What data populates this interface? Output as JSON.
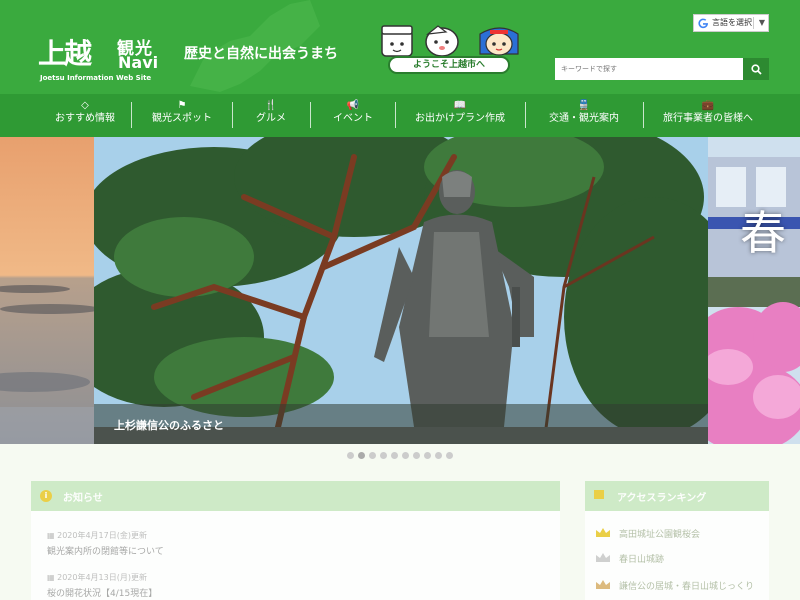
{
  "header": {
    "logo_mark": "上越",
    "logo_kanko": "観光",
    "logo_navi": "Navi",
    "logo_sub": "Joetsu Information Web Site",
    "tagline": "歴史と自然に出会うまち",
    "welcome": "ようこそ上越市へ",
    "language_button": "言語を選択",
    "search_placeholder": "キーワードで探す"
  },
  "nav": {
    "items": [
      {
        "label": "おすすめ情報",
        "icon": "diamond-icon"
      },
      {
        "label": "観光スポット",
        "icon": "flag-icon"
      },
      {
        "label": "グルメ",
        "icon": "cutlery-icon"
      },
      {
        "label": "イベント",
        "icon": "megaphone-icon"
      },
      {
        "label": "お出かけプラン作成",
        "icon": "book-icon"
      },
      {
        "label": "交通・観光案内",
        "icon": "train-icon"
      },
      {
        "label": "旅行事業者の皆様へ",
        "icon": "briefcase-icon"
      }
    ]
  },
  "hero": {
    "caption": "上杉謙信公のふるさと",
    "right_text": "春",
    "slide_count": 10,
    "active_slide": 1
  },
  "news": {
    "title": "お知らせ",
    "items": [
      {
        "date": "2020年4月17日(金)更新",
        "title": "観光案内所の閉館等について"
      },
      {
        "date": "2020年4月13日(月)更新",
        "title": "桜の開花状況【4/15現在】"
      }
    ]
  },
  "ranking": {
    "title": "アクセスランキング",
    "items": [
      {
        "label": "高田城址公園観桜会"
      },
      {
        "label": "春日山城跡"
      },
      {
        "label": "謙信公の居城・春日山城じっくり"
      }
    ]
  },
  "colors": {
    "header_green": "#3aaa3e",
    "nav_green": "#2f9a34",
    "accent_yellow": "#e9c82a"
  }
}
